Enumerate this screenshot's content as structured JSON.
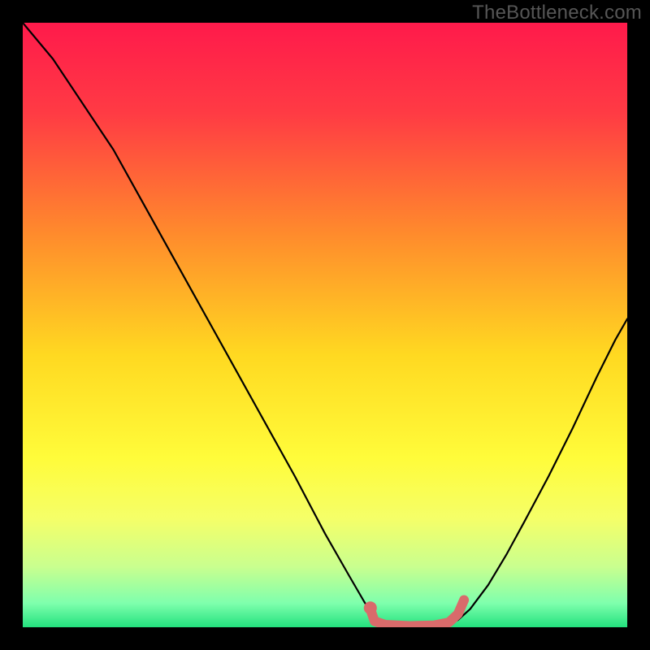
{
  "watermark": "TheBottleneck.com",
  "chart_data": {
    "type": "line",
    "title": "",
    "xlabel": "",
    "ylabel": "",
    "xlim": [
      0,
      1
    ],
    "ylim": [
      0,
      1
    ],
    "gradient_stops": [
      {
        "offset": 0.0,
        "color": "#ff1a4b"
      },
      {
        "offset": 0.15,
        "color": "#ff3b44"
      },
      {
        "offset": 0.35,
        "color": "#ff8b2c"
      },
      {
        "offset": 0.55,
        "color": "#ffd921"
      },
      {
        "offset": 0.72,
        "color": "#fffc3a"
      },
      {
        "offset": 0.82,
        "color": "#f5ff68"
      },
      {
        "offset": 0.9,
        "color": "#c9ff8f"
      },
      {
        "offset": 0.96,
        "color": "#7fffad"
      },
      {
        "offset": 1.0,
        "color": "#23e27e"
      }
    ],
    "series": [
      {
        "name": "bottleneck-curve",
        "color": "#000000",
        "width": 2.2,
        "points": [
          [
            0.0,
            1.0
          ],
          [
            0.05,
            0.94
          ],
          [
            0.11,
            0.85
          ],
          [
            0.15,
            0.79
          ],
          [
            0.2,
            0.7
          ],
          [
            0.25,
            0.61
          ],
          [
            0.3,
            0.52
          ],
          [
            0.35,
            0.43
          ],
          [
            0.4,
            0.34
          ],
          [
            0.45,
            0.25
          ],
          [
            0.5,
            0.155
          ],
          [
            0.54,
            0.085
          ],
          [
            0.565,
            0.042
          ],
          [
            0.58,
            0.018
          ],
          [
            0.595,
            0.006
          ],
          [
            0.61,
            0.002
          ],
          [
            0.64,
            0.002
          ],
          [
            0.67,
            0.002
          ],
          [
            0.7,
            0.004
          ],
          [
            0.72,
            0.012
          ],
          [
            0.74,
            0.03
          ],
          [
            0.77,
            0.07
          ],
          [
            0.8,
            0.12
          ],
          [
            0.83,
            0.175
          ],
          [
            0.87,
            0.25
          ],
          [
            0.91,
            0.33
          ],
          [
            0.95,
            0.415
          ],
          [
            0.98,
            0.475
          ],
          [
            1.0,
            0.51
          ]
        ]
      },
      {
        "name": "safe-zone-highlight",
        "color": "#d96b6b",
        "width": 12,
        "points": [
          [
            0.575,
            0.03
          ],
          [
            0.582,
            0.01
          ],
          [
            0.6,
            0.004
          ],
          [
            0.64,
            0.002
          ],
          [
            0.68,
            0.003
          ],
          [
            0.705,
            0.008
          ],
          [
            0.72,
            0.022
          ],
          [
            0.73,
            0.045
          ]
        ]
      }
    ],
    "markers": [
      {
        "name": "safe-zone-start-dot",
        "x": 0.575,
        "y": 0.032,
        "r": 8,
        "color": "#d96b6b"
      }
    ]
  }
}
